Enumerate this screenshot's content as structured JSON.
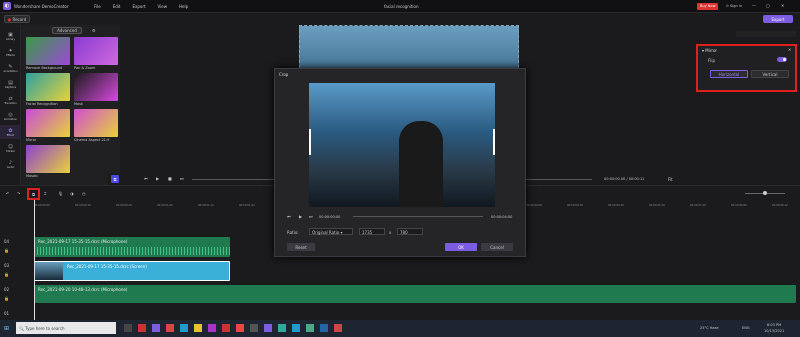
{
  "app": {
    "name": "Wondershare DemoCreator",
    "title": "facial recognition",
    "record": "Record",
    "export": "Export",
    "buy": "Buy Now",
    "signin": "Sign in",
    "menu": [
      "File",
      "Edit",
      "Export",
      "View",
      "Help"
    ]
  },
  "sidebar": [
    "Library",
    "Effects",
    "Annotation",
    "Captions",
    "Transition",
    "Animation",
    "Effect",
    "Sticker",
    "Audio"
  ],
  "library": {
    "tab": "Advanced",
    "items": [
      {
        "label": "Remove Background",
        "c1": "#3a9a45",
        "c2": "#9a4ad8"
      },
      {
        "label": "Pan & Zoom",
        "c1": "#8a3ad0",
        "c2": "#d06ae0"
      },
      {
        "label": "Facial Recognition",
        "c1": "#2fa0a0",
        "c2": "#e6d23a"
      },
      {
        "label": "Mask",
        "c1": "#1a1a1a",
        "c2": "#d84ae0"
      },
      {
        "label": "Mirror",
        "c1": "#c84ad8",
        "c2": "#e6d23a"
      },
      {
        "label": "Cinema Aspect 21:9",
        "c1": "#d050d0",
        "c2": "#e6d23a"
      },
      {
        "label": "Mosaic",
        "c1": "#9040d0",
        "c2": "#e6d23a"
      }
    ]
  },
  "preview": {
    "time": "00:00:00.00 / 00:00:11",
    "fit": "Fit"
  },
  "mirror": {
    "title": "Mirror",
    "flip": "Flip",
    "horizontal": "Horizontal",
    "vertical": "Vertical"
  },
  "crop": {
    "title": "Crop",
    "time_start": "00:00:00:00",
    "time_end": "00:00:04:00",
    "ratio_label": "Ratio:",
    "ratio": "Original Ratio",
    "width": "1735",
    "height": "780",
    "sep": "x",
    "reset": "Reset",
    "ok": "OK",
    "cancel": "Cancel"
  },
  "ruler": [
    "00:00:00:00",
    "00:00:00:10",
    "00:00:00:20",
    "00:00:01:02",
    "00:00:01:12",
    "00:00:01:22",
    "00:00:02:04",
    "00:00:02:14",
    "00:00:02:24",
    "00:00:03:06",
    "00:00:03:16",
    "00:00:03:26",
    "00:00:04:08",
    "00:00:04:18",
    "00:00:04:28",
    "00:00:05:10",
    "00:00:05:20",
    "00:00:06:00",
    "00:00:06:12",
    "00:00:06:22"
  ],
  "tracks": [
    {
      "num": "04",
      "clip": "Rec_2021-09-17 15-35-15.dcrc (Microphone)"
    },
    {
      "num": "03",
      "clip": "Rec_2021-09-17 15-35-15.dcrc (Screen)"
    },
    {
      "num": "02",
      "clip": "Rec_2021-09-20 10-48-13.dcrc (Microphone)"
    },
    {
      "num": "01",
      "clip": ""
    }
  ],
  "taskbar": {
    "search": "Type here to search",
    "weather": "25°C Haze",
    "lang": "ENG",
    "time": "8:03 PM",
    "date": "10/13/2021"
  },
  "colors": {
    "accent": "#7c5ce0",
    "audio": "#1f7a4f",
    "screen": "#3ab0d8",
    "highlight": "#e02020"
  }
}
